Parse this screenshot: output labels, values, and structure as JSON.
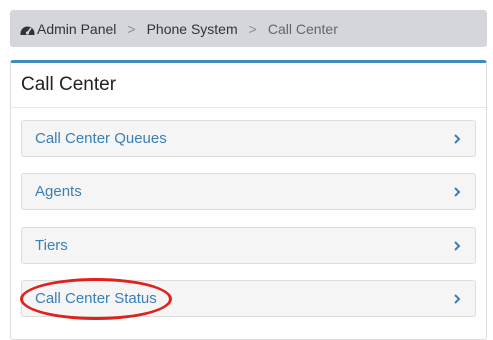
{
  "breadcrumb": {
    "items": [
      "Admin Panel",
      "Phone System",
      "Call Center"
    ],
    "separator": ">",
    "home_icon": "dashboard-gauge-icon"
  },
  "panel": {
    "title": "Call Center",
    "accent_color": "#3c8dbc",
    "items": [
      {
        "label": "Call Center Queues",
        "icon": "chevron-right-icon"
      },
      {
        "label": "Agents",
        "icon": "chevron-right-icon"
      },
      {
        "label": "Tiers",
        "icon": "chevron-right-icon"
      },
      {
        "label": "Call Center Status",
        "icon": "chevron-right-icon"
      }
    ]
  },
  "annotation": {
    "target": "Call Center Status",
    "color": "#e0201c"
  }
}
